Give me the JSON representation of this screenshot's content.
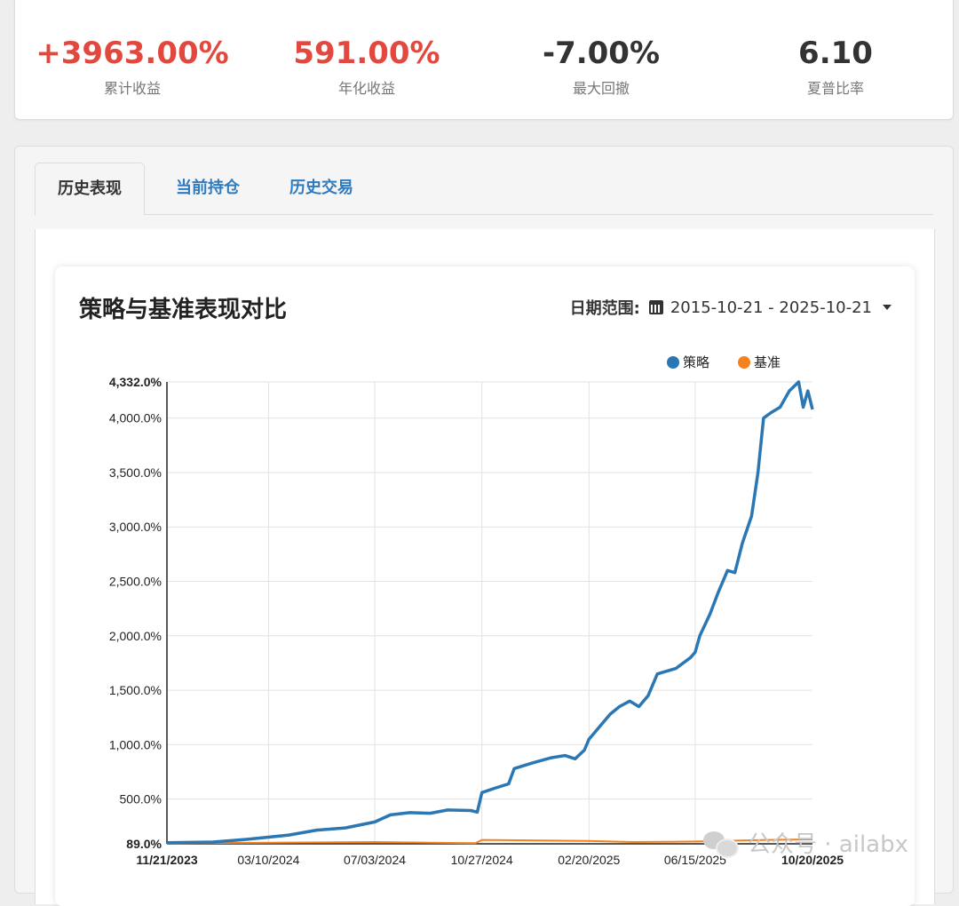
{
  "stats": [
    {
      "value": "+3963.00%",
      "label": "累计收益",
      "color": "#e2483d"
    },
    {
      "value": "591.00%",
      "label": "年化收益",
      "color": "#e2483d"
    },
    {
      "value": "-7.00%",
      "label": "最大回撤",
      "color": "#333333"
    },
    {
      "value": "6.10",
      "label": "夏普比率",
      "color": "#333333"
    }
  ],
  "tabs": [
    {
      "label": "历史表现",
      "active": true
    },
    {
      "label": "当前持仓",
      "active": false
    },
    {
      "label": "历史交易",
      "active": false
    }
  ],
  "chart_header": {
    "title": "策略与基准表现对比",
    "date_range_label": "日期范围:",
    "date_range_value": "2015-10-21 - 2025-10-21"
  },
  "watermark": {
    "text": "公众号 · ailabx"
  },
  "chart_data": {
    "type": "line",
    "ylim": [
      89,
      4332
    ],
    "y_ticks": [
      "89.0%",
      "500.0%",
      "1,000.0%",
      "1,500.0%",
      "2,000.0%",
      "2,500.0%",
      "3,000.0%",
      "3,500.0%",
      "4,000.0%",
      "4,332.0%"
    ],
    "y_tick_values": [
      89,
      500,
      1000,
      1500,
      2000,
      2500,
      3000,
      3500,
      4000,
      4332
    ],
    "x_range": [
      "2023-11-21",
      "2025-10-20"
    ],
    "x_ticks": [
      "11/21/2023",
      "03/10/2024",
      "07/03/2024",
      "10/27/2024",
      "02/20/2025",
      "06/15/2025",
      "10/20/2025"
    ],
    "x_tick_dates": [
      "2023-11-21",
      "2024-03-10",
      "2024-07-03",
      "2024-10-27",
      "2025-02-20",
      "2025-06-15",
      "2025-10-20"
    ],
    "grid": true,
    "legend_position": "top-right",
    "series": [
      {
        "name": "策略",
        "color": "#2a77b4",
        "points": [
          [
            "2023-11-21",
            100
          ],
          [
            "2024-01-10",
            105
          ],
          [
            "2024-02-15",
            130
          ],
          [
            "2024-03-10",
            150
          ],
          [
            "2024-04-01",
            170
          ],
          [
            "2024-05-01",
            215
          ],
          [
            "2024-06-01",
            235
          ],
          [
            "2024-07-03",
            290
          ],
          [
            "2024-07-20",
            355
          ],
          [
            "2024-08-10",
            375
          ],
          [
            "2024-09-01",
            370
          ],
          [
            "2024-09-20",
            400
          ],
          [
            "2024-10-15",
            395
          ],
          [
            "2024-10-22",
            380
          ],
          [
            "2024-10-27",
            560
          ],
          [
            "2024-11-10",
            600
          ],
          [
            "2024-11-25",
            640
          ],
          [
            "2024-12-01",
            780
          ],
          [
            "2024-12-20",
            830
          ],
          [
            "2025-01-10",
            880
          ],
          [
            "2025-01-25",
            900
          ],
          [
            "2025-02-05",
            870
          ],
          [
            "2025-02-15",
            950
          ],
          [
            "2025-02-20",
            1050
          ],
          [
            "2025-03-05",
            1180
          ],
          [
            "2025-03-15",
            1280
          ],
          [
            "2025-03-25",
            1350
          ],
          [
            "2025-04-05",
            1400
          ],
          [
            "2025-04-15",
            1350
          ],
          [
            "2025-04-25",
            1450
          ],
          [
            "2025-05-05",
            1650
          ],
          [
            "2025-05-25",
            1700
          ],
          [
            "2025-06-10",
            1800
          ],
          [
            "2025-06-15",
            1850
          ],
          [
            "2025-06-20",
            2000
          ],
          [
            "2025-07-01",
            2200
          ],
          [
            "2025-07-10",
            2400
          ],
          [
            "2025-07-20",
            2600
          ],
          [
            "2025-07-28",
            2580
          ],
          [
            "2025-08-05",
            2850
          ],
          [
            "2025-08-15",
            3100
          ],
          [
            "2025-08-22",
            3500
          ],
          [
            "2025-08-28",
            4000
          ],
          [
            "2025-09-05",
            4050
          ],
          [
            "2025-09-15",
            4100
          ],
          [
            "2025-09-25",
            4250
          ],
          [
            "2025-10-05",
            4332
          ],
          [
            "2025-10-10",
            4100
          ],
          [
            "2025-10-15",
            4250
          ],
          [
            "2025-10-20",
            4080
          ]
        ]
      },
      {
        "name": "基准",
        "color": "#f5821f",
        "points": [
          [
            "2023-11-21",
            95
          ],
          [
            "2024-03-10",
            100
          ],
          [
            "2024-07-03",
            105
          ],
          [
            "2024-10-20",
            95
          ],
          [
            "2024-10-27",
            125
          ],
          [
            "2025-02-20",
            115
          ],
          [
            "2025-04-08",
            105
          ],
          [
            "2025-06-15",
            110
          ],
          [
            "2025-09-01",
            125
          ],
          [
            "2025-10-20",
            130
          ]
        ]
      }
    ]
  }
}
